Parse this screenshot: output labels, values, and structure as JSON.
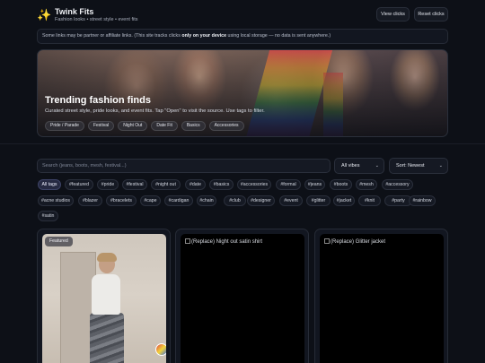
{
  "header": {
    "logo_glyph": "✨",
    "title": "Twink Fits",
    "subtitle": "Fashion looks • street style • event fits",
    "view_clicks": "View clicks",
    "reset_clicks": "Reset clicks"
  },
  "notice": {
    "before": "Some links may be partner or affiliate links. (This site tracks clicks ",
    "bold": "only on your device",
    "after": " using local storage — no data is sent anywhere.)"
  },
  "hero": {
    "title": "Trending fashion finds",
    "subtitle": "Curated street style, pride looks, and event fits. Tap \"Open\" to visit the source. Use tags to filter.",
    "tags": [
      "Pride / Parade",
      "Festival",
      "Night Out",
      "Date Fit",
      "Basics",
      "Accessories"
    ]
  },
  "filters": {
    "search_placeholder": "Search (jeans, boots, mesh, festival...)",
    "vibe": "All vibes",
    "sort": "Sort: Newest"
  },
  "tags": [
    "All tags",
    "#featured",
    "#pride",
    "#festival",
    "#night out",
    "#date",
    "#basics",
    "#accessories",
    "#formal",
    "#jeans",
    "#boots",
    "#mesh",
    "#accessory",
    "#acne studios",
    "#blazer",
    "#bracelets",
    "#cape",
    "#cardigan",
    "#chain",
    "#club",
    "#designer",
    "#event",
    "#glitter",
    "#jacket",
    "#knit",
    "#party",
    "#rainbow",
    "#satin"
  ],
  "active_tag": "All tags",
  "cards": [
    {
      "badge": "Featured",
      "alt": ""
    },
    {
      "badge": "",
      "alt": "(Replace) Night out satin shirt"
    },
    {
      "badge": "",
      "alt": "(Replace) Glitter jacket"
    }
  ],
  "colors": {
    "background": "#0d1017",
    "panel": "#121620",
    "active_tag": "#262a42",
    "logo": "#f5c542"
  }
}
